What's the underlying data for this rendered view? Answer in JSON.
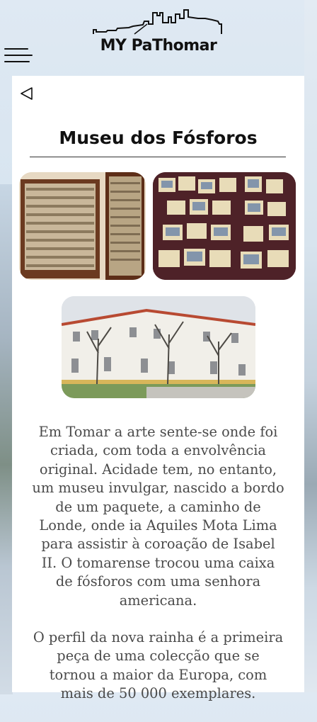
{
  "header": {
    "menu_icon": "hamburger-menu-icon",
    "logo_text": "MY PaThomar",
    "logo_icon": "castle-skyline-hiker-logo"
  },
  "page": {
    "back_icon": "back-triangle-icon",
    "title": "Museu dos Fósforos",
    "images": [
      "matchbox-display-cabinet-photo",
      "matchbox-collection-table-photo",
      "museum-building-courtyard-photo"
    ],
    "paragraphs": [
      "Em Tomar a arte sente-se onde foi criada, com toda a envolvência original. Acidade tem, no entanto, um museu invulgar, nascido a bordo de um paquete, a caminho de Londe, onde ia Aquiles Mota Lima para assistir à coroação de Isabel II. O tomarense trocou uma caixa de fósforos com uma senhora americana.",
      "O perfil da nova rainha é a primeira peça de uma colecção que se tornou a maior da Europa, com mais de 50 000 exemplares."
    ]
  },
  "colors": {
    "card": "#ffffff",
    "text": "#4a4a4a",
    "title": "#111111"
  }
}
